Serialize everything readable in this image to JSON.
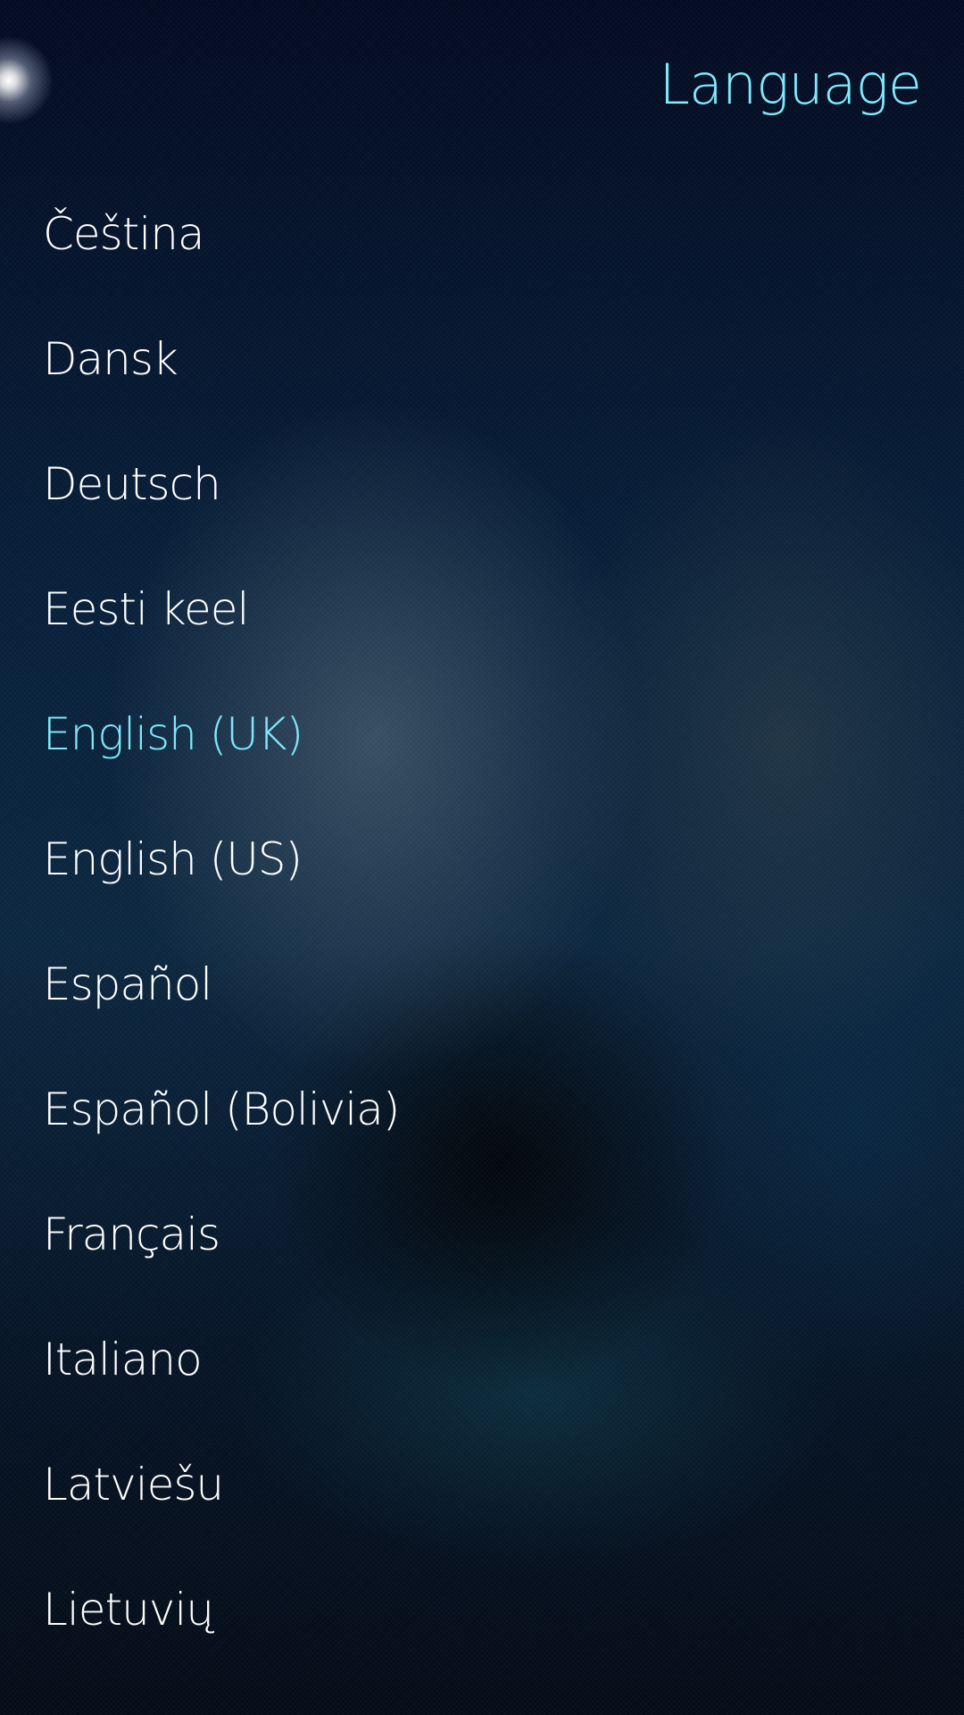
{
  "header": {
    "title": "Language"
  },
  "languages": [
    {
      "label": "Čeština",
      "selected": false
    },
    {
      "label": "Dansk",
      "selected": false
    },
    {
      "label": "Deutsch",
      "selected": false
    },
    {
      "label": "Eesti keel",
      "selected": false
    },
    {
      "label": "English (UK)",
      "selected": true
    },
    {
      "label": "English (US)",
      "selected": false
    },
    {
      "label": "Español",
      "selected": false
    },
    {
      "label": "Español (Bolivia)",
      "selected": false
    },
    {
      "label": "Français",
      "selected": false
    },
    {
      "label": "Italiano",
      "selected": false
    },
    {
      "label": "Latviešu",
      "selected": false
    },
    {
      "label": "Lietuvių",
      "selected": false
    }
  ],
  "colors": {
    "highlight": "#7fe8fb",
    "text": "#ffffff"
  }
}
